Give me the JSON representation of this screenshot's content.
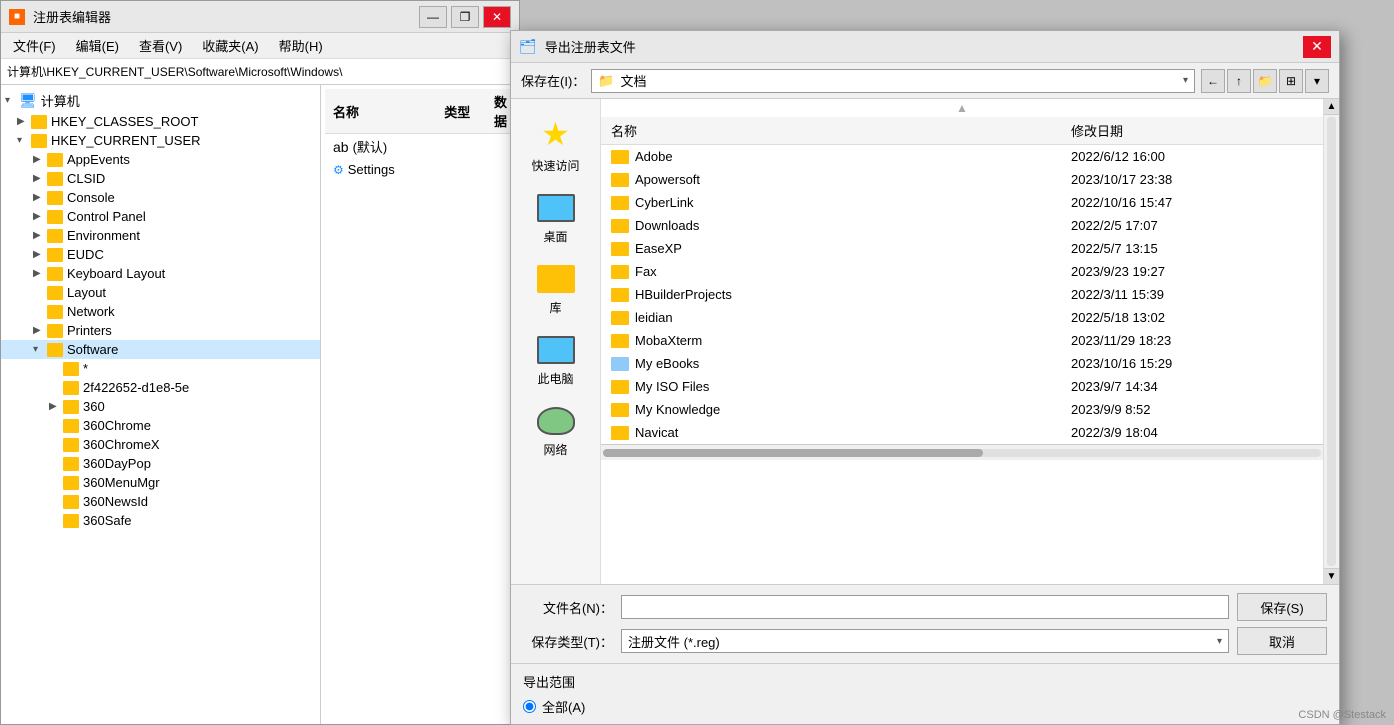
{
  "regEditor": {
    "title": "注册表编辑器",
    "menuItems": [
      "文件(F)",
      "编辑(E)",
      "查看(V)",
      "收藏夹(A)",
      "帮助(H)"
    ],
    "address": "计算机\\HKEY_CURRENT_USER\\Software\\Microsoft\\Windows\\",
    "treeItems": [
      {
        "label": "计算机",
        "level": 0,
        "expanded": true,
        "type": "computer"
      },
      {
        "label": "HKEY_CLASSES_ROOT",
        "level": 1,
        "expanded": false,
        "type": "folder"
      },
      {
        "label": "HKEY_CURRENT_USER",
        "level": 1,
        "expanded": true,
        "type": "folder"
      },
      {
        "label": "AppEvents",
        "level": 2,
        "expanded": false,
        "type": "folder"
      },
      {
        "label": "CLSID",
        "level": 2,
        "expanded": false,
        "type": "folder"
      },
      {
        "label": "Console",
        "level": 2,
        "expanded": false,
        "type": "folder"
      },
      {
        "label": "Control Panel",
        "level": 2,
        "expanded": false,
        "type": "folder"
      },
      {
        "label": "Environment",
        "level": 2,
        "expanded": false,
        "type": "folder"
      },
      {
        "label": "EUDC",
        "level": 2,
        "expanded": false,
        "type": "folder"
      },
      {
        "label": "Keyboard Layout",
        "level": 2,
        "expanded": false,
        "type": "folder"
      },
      {
        "label": "Layout",
        "level": 2,
        "expanded": false,
        "type": "folder"
      },
      {
        "label": "Network",
        "level": 2,
        "expanded": false,
        "type": "folder"
      },
      {
        "label": "Printers",
        "level": 2,
        "expanded": false,
        "type": "folder"
      },
      {
        "label": "Software",
        "level": 2,
        "expanded": true,
        "type": "folder"
      },
      {
        "label": "*",
        "level": 3,
        "expanded": false,
        "type": "folder"
      },
      {
        "label": "2f422652-d1e8-5e",
        "level": 3,
        "expanded": false,
        "type": "folder"
      },
      {
        "label": "360",
        "level": 3,
        "expanded": false,
        "type": "folder"
      },
      {
        "label": "360Chrome",
        "level": 3,
        "expanded": false,
        "type": "folder"
      },
      {
        "label": "360ChromeX",
        "level": 3,
        "expanded": false,
        "type": "folder"
      },
      {
        "label": "360DayPop",
        "level": 3,
        "expanded": false,
        "type": "folder"
      },
      {
        "label": "360MenuMgr",
        "level": 3,
        "expanded": false,
        "type": "folder"
      },
      {
        "label": "360NewsId",
        "level": 3,
        "expanded": false,
        "type": "folder"
      },
      {
        "label": "360Safe",
        "level": 3,
        "expanded": false,
        "type": "folder"
      }
    ],
    "rightPanel": {
      "columns": [
        "名称",
        "类型",
        "数据"
      ],
      "rows": [
        {
          "name": "(默认)",
          "type": "",
          "data": ""
        },
        {
          "name": "Settings",
          "type": "",
          "data": ""
        }
      ]
    }
  },
  "exportDialog": {
    "title": "导出注册表文件",
    "icon": "🗂",
    "toolbar": {
      "label": "保存在(I)：",
      "currentPath": "文档",
      "buttons": [
        "←",
        "↑",
        "📁+",
        "⊞"
      ]
    },
    "leftNav": [
      {
        "label": "快速访问",
        "iconType": "star"
      },
      {
        "label": "桌面",
        "iconType": "desktop"
      },
      {
        "label": "库",
        "iconType": "lib"
      },
      {
        "label": "此电脑",
        "iconType": "pc"
      },
      {
        "label": "网络",
        "iconType": "net"
      }
    ],
    "fileList": {
      "columns": [
        "名称",
        "修改日期"
      ],
      "rows": [
        {
          "name": "Adobe",
          "date": "2022/6/12 16:00",
          "iconType": "folder"
        },
        {
          "name": "Apowersoft",
          "date": "2023/10/17 23:38",
          "iconType": "folder"
        },
        {
          "name": "CyberLink",
          "date": "2022/10/16 15:47",
          "iconType": "folder"
        },
        {
          "name": "Downloads",
          "date": "2022/2/5 17:07",
          "iconType": "folder"
        },
        {
          "name": "EaseXP",
          "date": "2022/5/7 13:15",
          "iconType": "folder"
        },
        {
          "name": "Fax",
          "date": "2023/9/23 19:27",
          "iconType": "folder"
        },
        {
          "name": "HBuilderProjects",
          "date": "2022/3/11 15:39",
          "iconType": "folder"
        },
        {
          "name": "leidian",
          "date": "2022/5/18 13:02",
          "iconType": "folder"
        },
        {
          "name": "MobaXterm",
          "date": "2023/11/29 18:23",
          "iconType": "folder"
        },
        {
          "name": "My eBooks",
          "date": "2023/10/16 15:29",
          "iconType": "special"
        },
        {
          "name": "My ISO Files",
          "date": "2023/9/7 14:34",
          "iconType": "folder"
        },
        {
          "name": "My Knowledge",
          "date": "2023/9/9 8:52",
          "iconType": "folder"
        },
        {
          "name": "Navicat",
          "date": "2022/3/9 18:04",
          "iconType": "folder"
        }
      ]
    },
    "footer": {
      "fileNameLabel": "文件名(N)：",
      "fileNameValue": "",
      "fileTypeLabel": "保存类型(T)：",
      "fileTypeValue": "注册文件 (*.reg)",
      "saveBtn": "保存(S)",
      "cancelBtn": "取消"
    },
    "exportRange": {
      "title": "导出范围",
      "options": [
        "全部(A)"
      ]
    }
  },
  "watermark": "CSDN @Stestack"
}
